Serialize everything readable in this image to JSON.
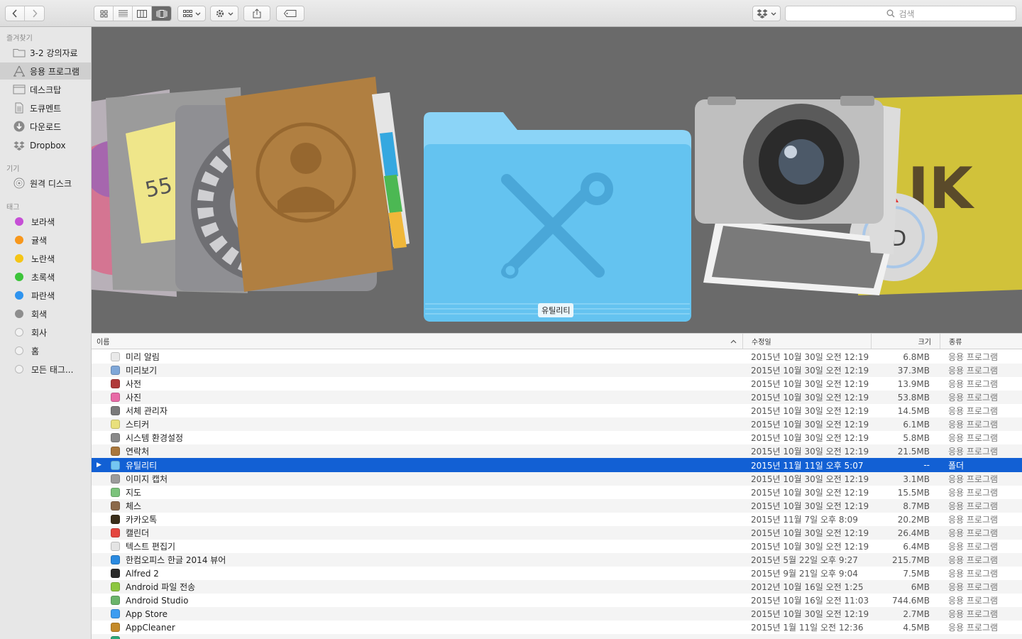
{
  "toolbar": {
    "search_placeholder": "검색"
  },
  "sidebar": {
    "favorites_header": "즐겨찾기",
    "favorites": [
      {
        "label": "3-2 강의자료",
        "icon": "folder-icon"
      },
      {
        "label": "응용 프로그램",
        "icon": "applications-icon",
        "selected": true
      },
      {
        "label": "데스크탑",
        "icon": "desktop-icon"
      },
      {
        "label": "도큐멘트",
        "icon": "document-icon"
      },
      {
        "label": "다운로드",
        "icon": "download-icon"
      },
      {
        "label": "Dropbox",
        "icon": "dropbox-icon"
      }
    ],
    "devices_header": "기기",
    "devices": [
      {
        "label": "원격 디스크",
        "icon": "disc-icon"
      }
    ],
    "tags_header": "태그",
    "tags": [
      {
        "label": "보라색",
        "color": "#c64fd6"
      },
      {
        "label": "귤색",
        "color": "#f7971c"
      },
      {
        "label": "노란색",
        "color": "#f5c516"
      },
      {
        "label": "초록색",
        "color": "#3cc43a"
      },
      {
        "label": "파란색",
        "color": "#2f94ef"
      },
      {
        "label": "회색",
        "color": "#8e8e8e"
      },
      {
        "label": "회사",
        "color": ""
      },
      {
        "label": "홈",
        "color": ""
      },
      {
        "label": "모든 태그...",
        "color": ""
      }
    ]
  },
  "coverflow": {
    "selected_label": "유틸리티"
  },
  "list": {
    "headers": {
      "name": "이름",
      "date": "수정일",
      "size": "크기",
      "kind": "종류"
    },
    "rows": [
      {
        "name": "미리 알림",
        "date": "2015년 10월 30일 오전 12:19",
        "size": "6.8MB",
        "kind": "응용 프로그램",
        "icon": "reminders-icon",
        "color": "#e9e9e9"
      },
      {
        "name": "미리보기",
        "date": "2015년 10월 30일 오전 12:19",
        "size": "37.3MB",
        "kind": "응용 프로그램",
        "icon": "preview-icon",
        "color": "#7fa7d8"
      },
      {
        "name": "사전",
        "date": "2015년 10월 30일 오전 12:19",
        "size": "13.9MB",
        "kind": "응용 프로그램",
        "icon": "dictionary-icon",
        "color": "#b03a3a"
      },
      {
        "name": "사진",
        "date": "2015년 10월 30일 오전 12:19",
        "size": "53.8MB",
        "kind": "응용 프로그램",
        "icon": "photos-icon",
        "color": "#e86aa6"
      },
      {
        "name": "서체 관리자",
        "date": "2015년 10월 30일 오전 12:19",
        "size": "14.5MB",
        "kind": "응용 프로그램",
        "icon": "font-book-icon",
        "color": "#7a7a7a"
      },
      {
        "name": "스티커",
        "date": "2015년 10월 30일 오전 12:19",
        "size": "6.1MB",
        "kind": "응용 프로그램",
        "icon": "stickies-icon",
        "color": "#e9e07c"
      },
      {
        "name": "시스템 환경설정",
        "date": "2015년 10월 30일 오전 12:19",
        "size": "5.8MB",
        "kind": "응용 프로그램",
        "icon": "system-preferences-icon",
        "color": "#8a8a8a"
      },
      {
        "name": "연락처",
        "date": "2015년 10월 30일 오전 12:19",
        "size": "21.5MB",
        "kind": "응용 프로그램",
        "icon": "contacts-icon",
        "color": "#a9773c"
      },
      {
        "name": "유틸리티",
        "date": "2015년 11월 11일 오후 5:07",
        "size": "--",
        "kind": "폴더",
        "icon": "folder-icon",
        "color": "#74c7f2",
        "selected": true,
        "expandable": true
      },
      {
        "name": "이미지 캡처",
        "date": "2015년 10월 30일 오전 12:19",
        "size": "3.1MB",
        "kind": "응용 프로그램",
        "icon": "image-capture-icon",
        "color": "#9b9b9b"
      },
      {
        "name": "지도",
        "date": "2015년 10월 30일 오전 12:19",
        "size": "15.5MB",
        "kind": "응용 프로그램",
        "icon": "maps-icon",
        "color": "#7cc37c"
      },
      {
        "name": "체스",
        "date": "2015년 10월 30일 오전 12:19",
        "size": "8.7MB",
        "kind": "응용 프로그램",
        "icon": "chess-icon",
        "color": "#8c6a4b"
      },
      {
        "name": "카카오톡",
        "date": "2015년 11월 7일 오후 8:09",
        "size": "20.2MB",
        "kind": "응용 프로그램",
        "icon": "kakaotalk-icon",
        "color": "#3a2e1a"
      },
      {
        "name": "캘린더",
        "date": "2015년 10월 30일 오전 12:19",
        "size": "26.4MB",
        "kind": "응용 프로그램",
        "icon": "calendar-icon",
        "color": "#e4463f"
      },
      {
        "name": "텍스트 편집기",
        "date": "2015년 10월 30일 오전 12:19",
        "size": "6.4MB",
        "kind": "응용 프로그램",
        "icon": "textedit-icon",
        "color": "#e4e4e4"
      },
      {
        "name": "한컴오피스 한글 2014 뷰어",
        "date": "2015년 5월 22일 오후 9:27",
        "size": "215.7MB",
        "kind": "응용 프로그램",
        "icon": "hancom-viewer-icon",
        "color": "#2a8ae0"
      },
      {
        "name": "Alfred 2",
        "date": "2015년 9월 21일 오후 9:04",
        "size": "7.5MB",
        "kind": "응용 프로그램",
        "icon": "alfred-icon",
        "color": "#2a2a2a"
      },
      {
        "name": "Android 파일 전송",
        "date": "2012년 10월 16일 오전 1:25",
        "size": "6MB",
        "kind": "응용 프로그램",
        "icon": "android-file-transfer-icon",
        "color": "#8cc63f"
      },
      {
        "name": "Android Studio",
        "date": "2015년 10월 16일 오전 11:03",
        "size": "744.6MB",
        "kind": "응용 프로그램",
        "icon": "android-studio-icon",
        "color": "#6bb46b"
      },
      {
        "name": "App Store",
        "date": "2015년 10월 30일 오전 12:19",
        "size": "2.7MB",
        "kind": "응용 프로그램",
        "icon": "app-store-icon",
        "color": "#3c9cf0"
      },
      {
        "name": "AppCleaner",
        "date": "2015년 1월 11일 오전 12:36",
        "size": "4.5MB",
        "kind": "응용 프로그램",
        "icon": "appcleaner-icon",
        "color": "#c48a2a"
      },
      {
        "name": "",
        "date": "",
        "size": "",
        "kind": "",
        "icon": "app-icon",
        "color": "#2aa87a"
      }
    ]
  }
}
